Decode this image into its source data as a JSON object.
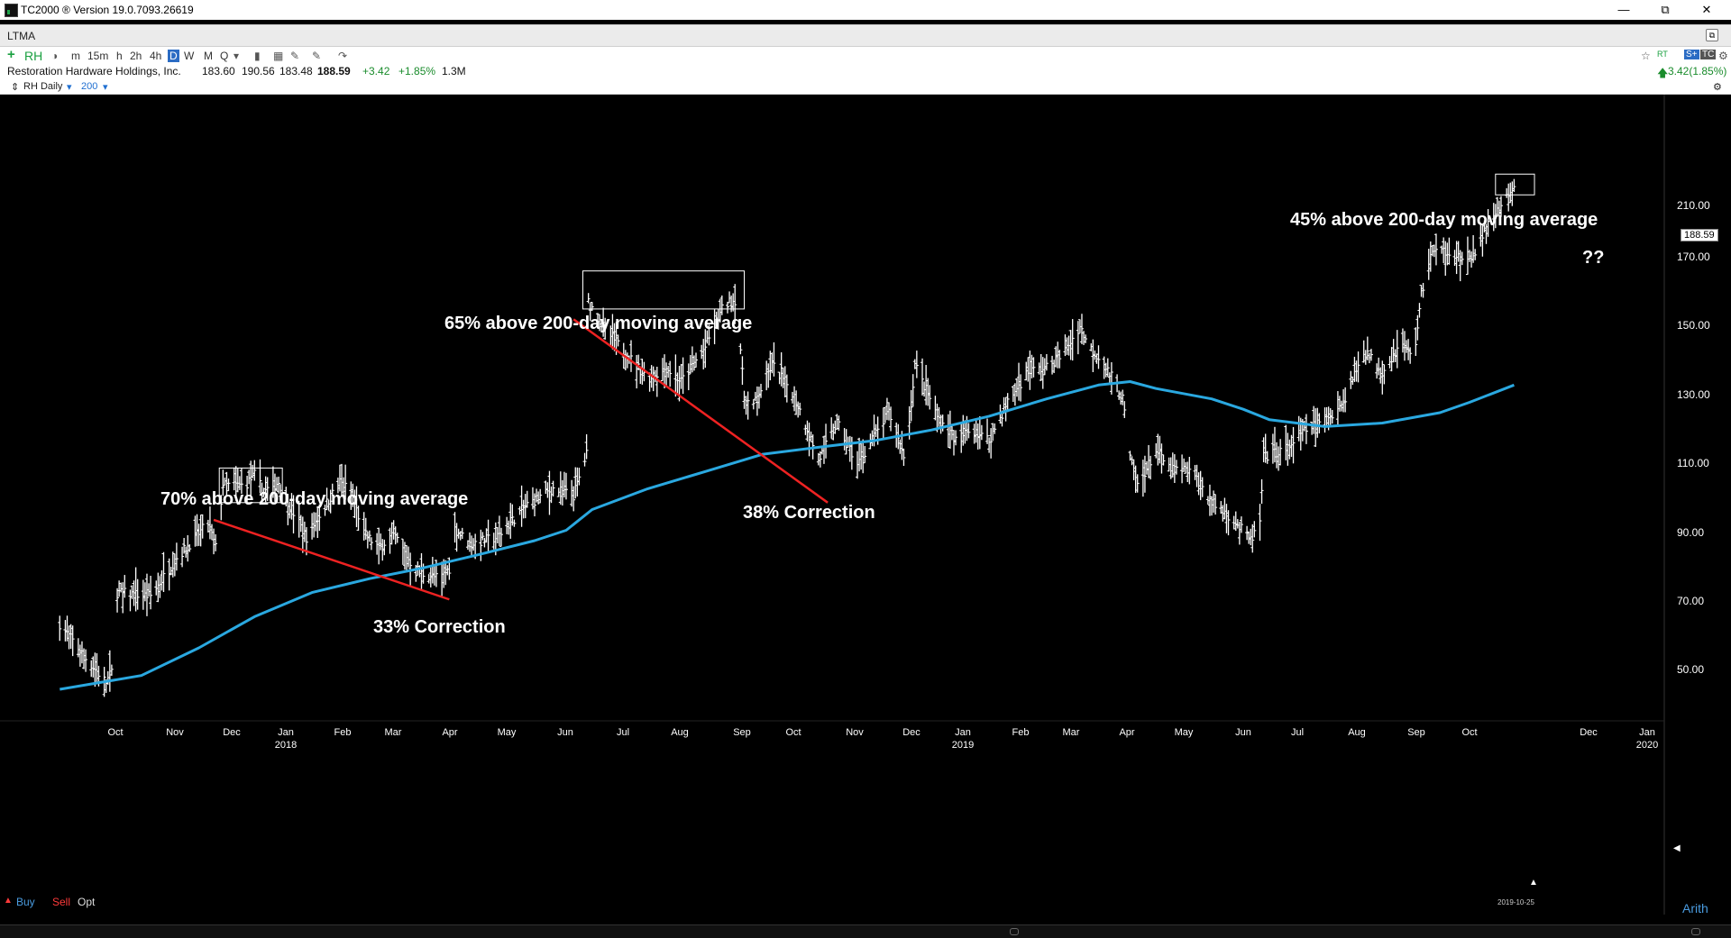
{
  "window": {
    "title": "TC2000 ® Version 19.0.7093.26619"
  },
  "tab": {
    "label": "LTMA"
  },
  "toolbar": {
    "plus": "+",
    "symbol": "RH",
    "periods": [
      "m",
      "15m",
      "h",
      "2h",
      "4h",
      "D",
      "W",
      "M",
      "Q"
    ]
  },
  "quote": {
    "company": "Restoration Hardware Holdings, Inc.",
    "open": "183.60",
    "high": "190.56",
    "low": "183.48",
    "last": "188.59",
    "change": "+3.42",
    "change_pct": "+1.85%",
    "volume": "1.3M",
    "right_change": "3.42(1.85%)"
  },
  "settings": {
    "chart_name": "RH Daily",
    "ma_period": "200"
  },
  "trade_buttons": {
    "buy": "Buy",
    "sell": "Sell",
    "opt": "Opt"
  },
  "annotations": {
    "a70": "70% above 200-day moving average",
    "a65": "65% above 200-day moving average",
    "a45": "45% above 200-day moving average",
    "c33": "33% Correction",
    "c38": "38% Correction",
    "q": "??"
  },
  "scale_mode": "Arith",
  "end_date": "2019-10-25",
  "price_tag": "188.59",
  "colors": {
    "ma": "#2aa8e0",
    "correction": "#ee2222",
    "bars": "#ffffff",
    "background": "#000000"
  },
  "chart_data": {
    "type": "ohlc-bar",
    "ylim": [
      40,
      215
    ],
    "y_ticks": [
      "210.00",
      "170.00",
      "150.00",
      "130.00",
      "110.00",
      "90.00",
      "70.00",
      "50.00"
    ],
    "x_ticks": [
      "Oct",
      "Nov",
      "Dec",
      "Jan",
      "Feb",
      "Mar",
      "Apr",
      "May",
      "Jun",
      "Jul",
      "Aug",
      "Sep",
      "Oct",
      "Nov",
      "Dec",
      "Jan",
      "Feb",
      "Mar",
      "Apr",
      "May",
      "Jun",
      "Jul",
      "Aug",
      "Sep",
      "Oct",
      "Dec",
      "Jan"
    ],
    "x_years": [
      "2018",
      "2019",
      "2020"
    ],
    "price_path": [
      [
        "2017-09-01",
        63
      ],
      [
        "2017-09-15",
        53
      ],
      [
        "2017-09-26",
        46
      ],
      [
        "2017-09-29",
        49
      ],
      [
        "2017-10-02",
        72
      ],
      [
        "2017-10-20",
        71
      ],
      [
        "2017-11-03",
        82
      ],
      [
        "2017-11-20",
        92
      ],
      [
        "2017-11-24",
        85
      ],
      [
        "2017-11-28",
        103
      ],
      [
        "2017-12-10",
        103
      ],
      [
        "2017-12-15",
        106
      ],
      [
        "2017-12-20",
        101
      ],
      [
        "2017-12-28",
        104
      ],
      [
        "2018-01-05",
        95
      ],
      [
        "2018-01-12",
        88
      ],
      [
        "2018-01-22",
        97
      ],
      [
        "2018-01-30",
        104
      ],
      [
        "2018-02-05",
        101
      ],
      [
        "2018-02-12",
        89
      ],
      [
        "2018-02-20",
        85
      ],
      [
        "2018-02-28",
        89
      ],
      [
        "2018-03-12",
        78
      ],
      [
        "2018-03-25",
        76
      ],
      [
        "2018-03-30",
        79
      ],
      [
        "2018-04-01",
        91
      ],
      [
        "2018-04-10",
        86
      ],
      [
        "2018-04-25",
        88
      ],
      [
        "2018-05-10",
        97
      ],
      [
        "2018-05-25",
        102
      ],
      [
        "2018-06-05",
        100
      ],
      [
        "2018-06-12",
        112
      ],
      [
        "2018-06-13",
        156
      ],
      [
        "2018-06-22",
        148
      ],
      [
        "2018-07-05",
        140
      ],
      [
        "2018-07-15",
        134
      ],
      [
        "2018-07-25",
        137
      ],
      [
        "2018-08-02",
        133
      ],
      [
        "2018-08-15",
        143
      ],
      [
        "2018-08-25",
        155
      ],
      [
        "2018-09-01",
        157
      ],
      [
        "2018-09-05",
        128
      ],
      [
        "2018-09-10",
        126
      ],
      [
        "2018-09-20",
        138
      ],
      [
        "2018-10-01",
        130
      ],
      [
        "2018-10-10",
        118
      ],
      [
        "2018-10-15",
        110
      ],
      [
        "2018-10-25",
        121
      ],
      [
        "2018-11-05",
        109
      ],
      [
        "2018-11-15",
        118
      ],
      [
        "2018-11-22",
        124
      ],
      [
        "2018-12-01",
        110
      ],
      [
        "2018-12-06",
        138
      ],
      [
        "2018-12-18",
        123
      ],
      [
        "2018-12-28",
        116
      ],
      [
        "2019-01-05",
        119
      ],
      [
        "2019-01-15",
        116
      ],
      [
        "2019-01-25",
        127
      ],
      [
        "2019-02-05",
        136
      ],
      [
        "2019-02-15",
        137
      ],
      [
        "2019-02-25",
        142
      ],
      [
        "2019-03-05",
        149
      ],
      [
        "2019-03-10",
        143
      ],
      [
        "2019-03-15",
        140
      ],
      [
        "2019-03-25",
        132
      ],
      [
        "2019-03-28",
        128
      ],
      [
        "2019-04-01",
        111
      ],
      [
        "2019-04-05",
        103
      ],
      [
        "2019-04-15",
        113
      ],
      [
        "2019-04-22",
        108
      ],
      [
        "2019-05-05",
        107
      ],
      [
        "2019-05-15",
        98
      ],
      [
        "2019-05-25",
        94
      ],
      [
        "2019-06-05",
        87
      ],
      [
        "2019-06-10",
        92
      ],
      [
        "2019-06-12",
        111
      ],
      [
        "2019-06-25",
        114
      ],
      [
        "2019-07-05",
        119
      ],
      [
        "2019-07-15",
        122
      ],
      [
        "2019-07-25",
        127
      ],
      [
        "2019-08-05",
        142
      ],
      [
        "2019-08-15",
        136
      ],
      [
        "2019-08-25",
        144
      ],
      [
        "2019-09-01",
        140
      ],
      [
        "2019-09-05",
        158
      ],
      [
        "2019-09-10",
        170
      ],
      [
        "2019-09-20",
        171
      ],
      [
        "2019-09-30",
        167
      ],
      [
        "2019-10-05",
        172
      ],
      [
        "2019-10-15",
        182
      ],
      [
        "2019-10-20",
        185
      ],
      [
        "2019-10-25",
        188.59
      ]
    ],
    "ma200_path": [
      [
        "2017-09-01",
        44
      ],
      [
        "2017-10-15",
        48
      ],
      [
        "2017-11-15",
        56
      ],
      [
        "2017-12-15",
        65
      ],
      [
        "2018-01-15",
        72
      ],
      [
        "2018-02-15",
        76
      ],
      [
        "2018-03-15",
        79
      ],
      [
        "2018-04-15",
        83
      ],
      [
        "2018-05-15",
        87
      ],
      [
        "2018-06-01",
        90
      ],
      [
        "2018-06-15",
        96
      ],
      [
        "2018-07-15",
        102
      ],
      [
        "2018-08-15",
        107
      ],
      [
        "2018-09-15",
        112
      ],
      [
        "2018-10-15",
        114
      ],
      [
        "2018-11-15",
        116
      ],
      [
        "2018-12-15",
        119
      ],
      [
        "2019-01-15",
        123
      ],
      [
        "2019-02-15",
        128
      ],
      [
        "2019-03-15",
        132
      ],
      [
        "2019-04-01",
        133
      ],
      [
        "2019-04-15",
        131
      ],
      [
        "2019-05-15",
        128
      ],
      [
        "2019-06-01",
        125
      ],
      [
        "2019-06-15",
        122
      ],
      [
        "2019-07-15",
        120
      ],
      [
        "2019-08-15",
        121
      ],
      [
        "2019-09-15",
        124
      ],
      [
        "2019-10-01",
        127
      ],
      [
        "2019-10-25",
        132
      ]
    ],
    "correction_lines": [
      {
        "label": "33% Correction",
        "from": [
          "2017-11-23",
          93
        ],
        "to": [
          "2018-03-30",
          70
        ]
      },
      {
        "label": "38% Correction",
        "from": [
          "2018-06-05",
          151
        ],
        "to": [
          "2018-10-20",
          98
        ]
      }
    ],
    "peak_boxes": [
      {
        "from": [
          "2017-11-26",
          108
        ],
        "to": [
          "2017-12-30",
          98
        ]
      },
      {
        "from": [
          "2018-06-10",
          165
        ],
        "to": [
          "2018-09-05",
          154
        ]
      },
      {
        "from": [
          "2019-10-15",
          193
        ],
        "to": [
          "2019-11-05",
          187
        ]
      }
    ]
  }
}
